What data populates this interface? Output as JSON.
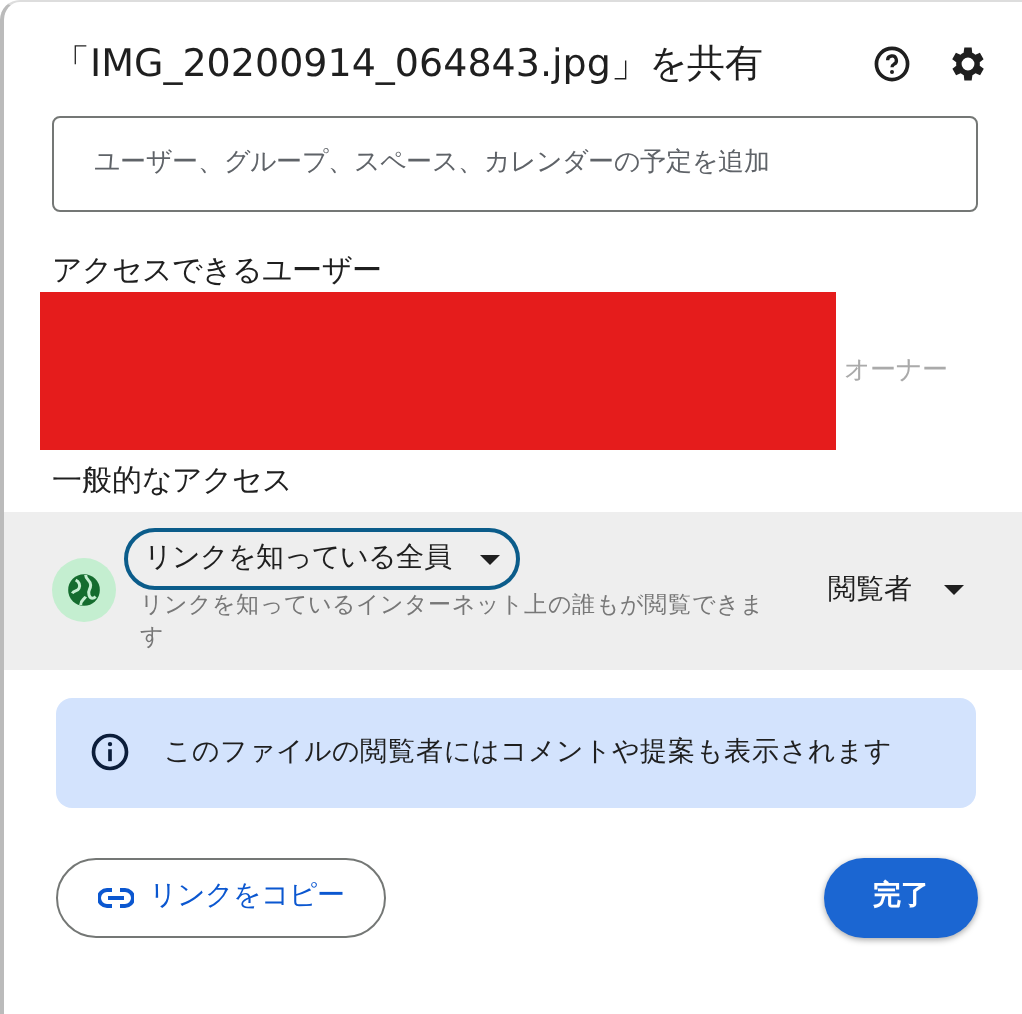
{
  "dialog": {
    "title": "「IMG_20200914_064843.jpg」を共有"
  },
  "search": {
    "placeholder": "ユーザー、グループ、スペース、カレンダーの予定を追加"
  },
  "people_heading": "アクセスできるユーザー",
  "people": [
    {
      "redacted": true,
      "role": "オーナー"
    }
  ],
  "general_heading": "一般的なアクセス",
  "general_access": {
    "scope": "リンクを知っている全員",
    "description": "リンクを知っているインターネット上の誰もが閲覧できます",
    "focused": true,
    "role": "閲覧者"
  },
  "info": "このファイルの閲覧者にはコメントや提案も表示されます",
  "buttons": [
    {
      "kind": "copy",
      "label": "リンクをコピー"
    },
    {
      "kind": "done",
      "label": "完了"
    }
  ]
}
